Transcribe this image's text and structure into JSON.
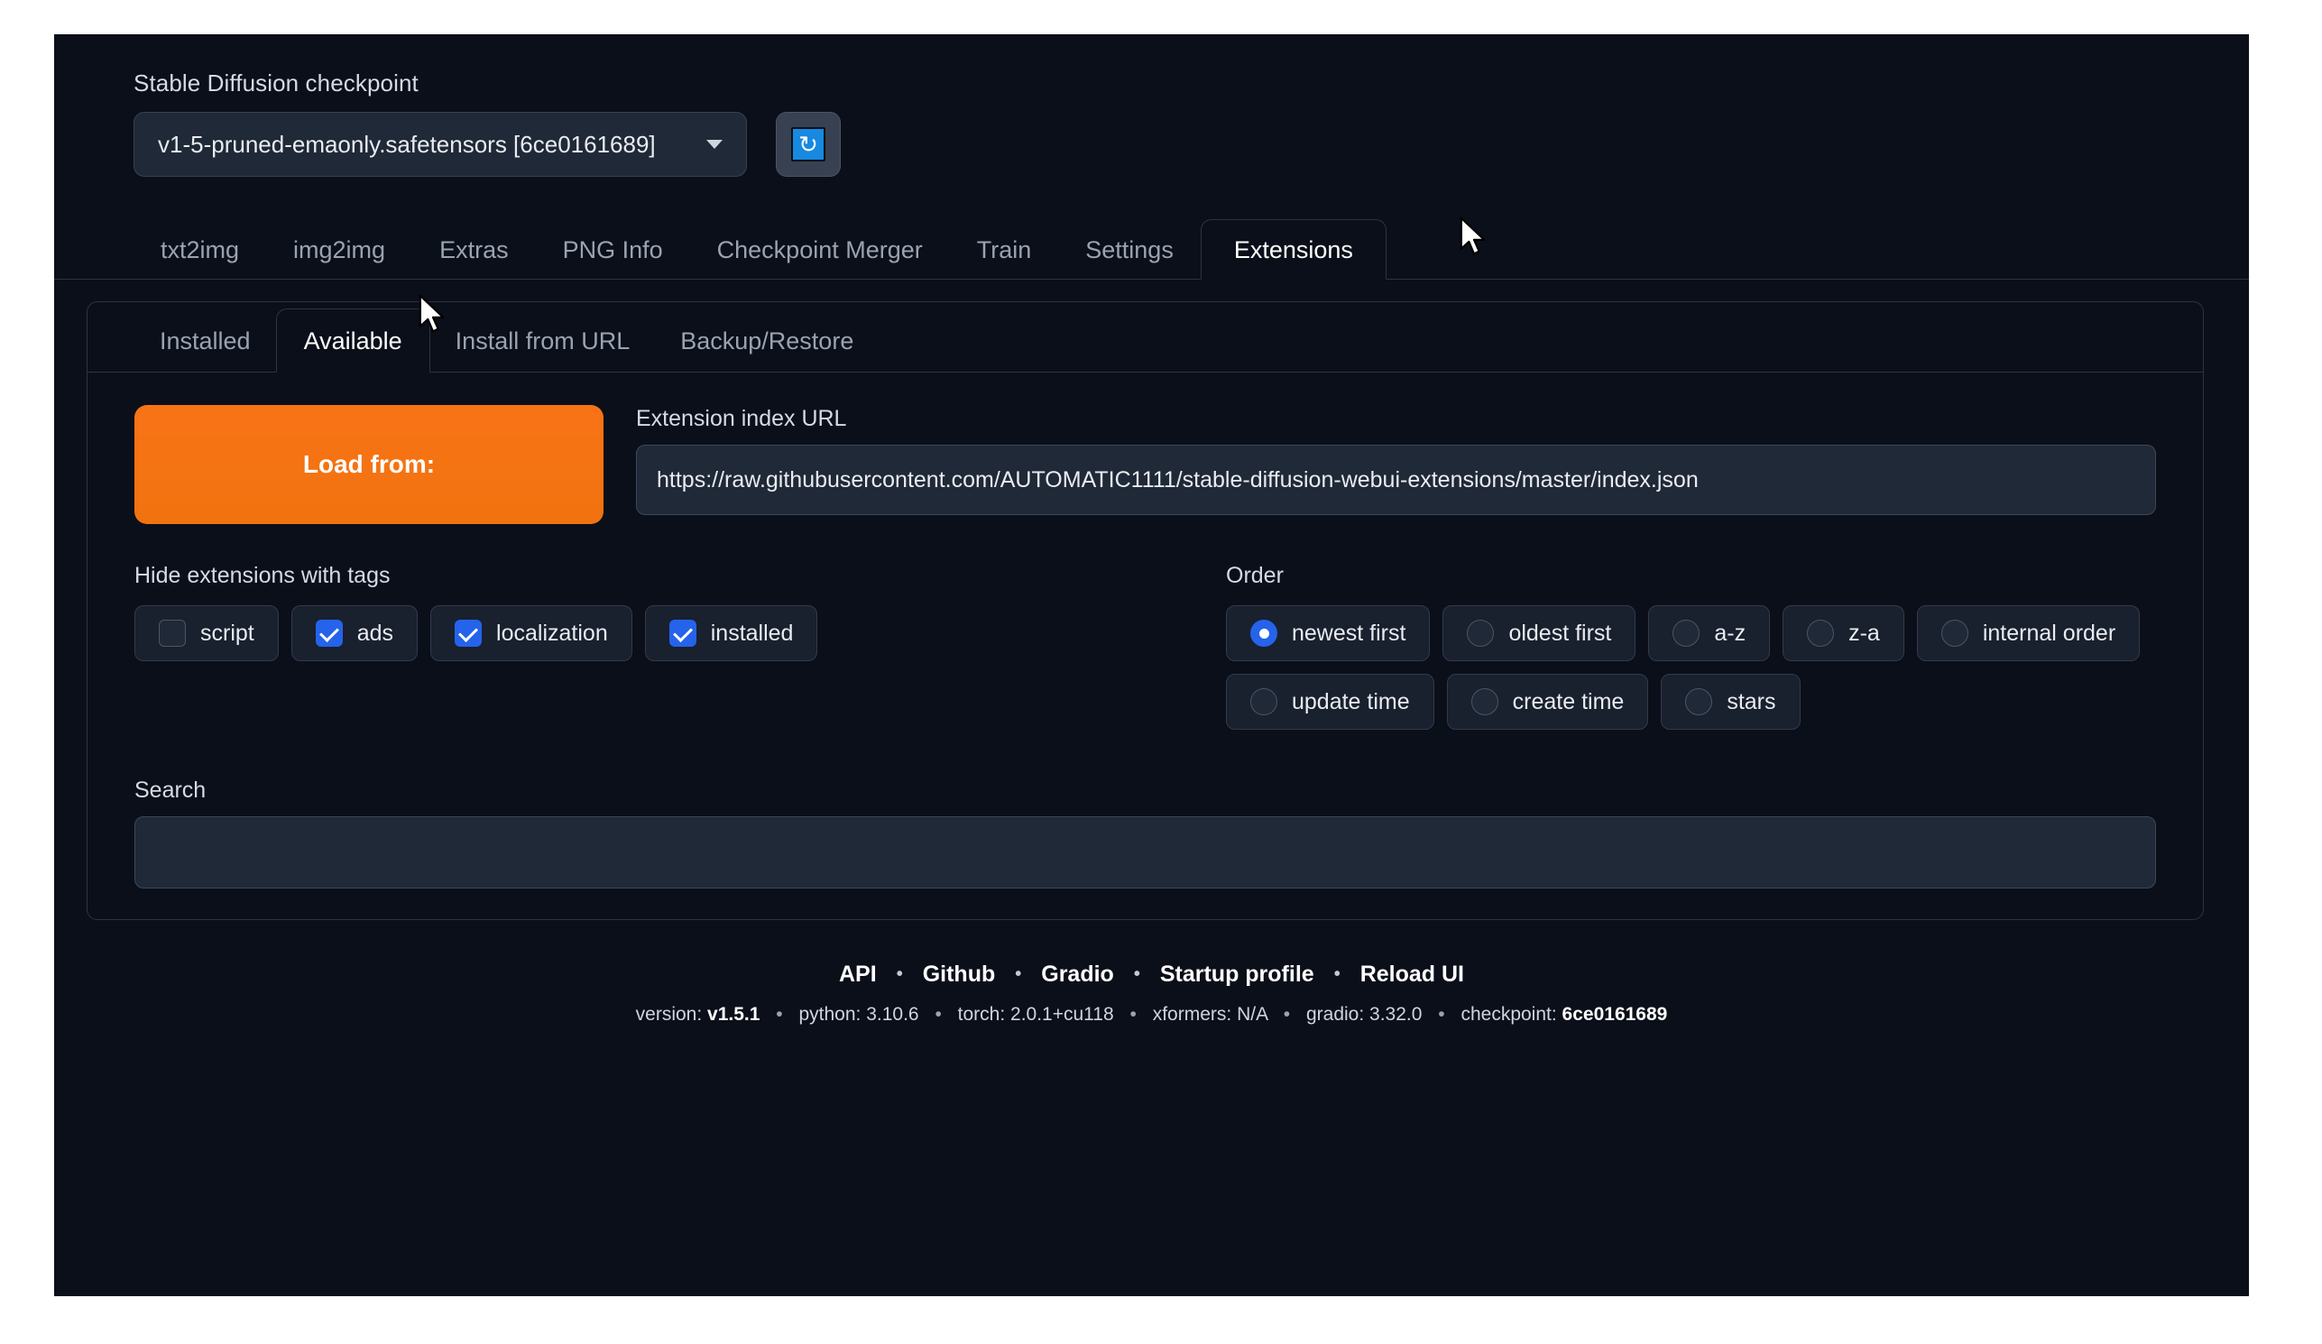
{
  "checkpoint": {
    "label": "Stable Diffusion checkpoint",
    "value": "v1-5-pruned-emaonly.safetensors [6ce0161689]",
    "refresh_icon": "refresh-icon"
  },
  "main_tabs": [
    {
      "label": "txt2img",
      "selected": false
    },
    {
      "label": "img2img",
      "selected": false
    },
    {
      "label": "Extras",
      "selected": false
    },
    {
      "label": "PNG Info",
      "selected": false
    },
    {
      "label": "Checkpoint Merger",
      "selected": false
    },
    {
      "label": "Train",
      "selected": false
    },
    {
      "label": "Settings",
      "selected": false
    },
    {
      "label": "Extensions",
      "selected": true
    }
  ],
  "sub_tabs": [
    {
      "label": "Installed",
      "selected": false
    },
    {
      "label": "Available",
      "selected": true
    },
    {
      "label": "Install from URL",
      "selected": false
    },
    {
      "label": "Backup/Restore",
      "selected": false
    }
  ],
  "extensions": {
    "load_button": "Load from:",
    "index_url_label": "Extension index URL",
    "index_url_value": "https://raw.githubusercontent.com/AUTOMATIC1111/stable-diffusion-webui-extensions/master/index.json",
    "hide_tags_label": "Hide extensions with tags",
    "hide_tags": [
      {
        "label": "script",
        "checked": false
      },
      {
        "label": "ads",
        "checked": true
      },
      {
        "label": "localization",
        "checked": true
      },
      {
        "label": "installed",
        "checked": true
      }
    ],
    "order_label": "Order",
    "order_row1": [
      {
        "label": "newest first",
        "checked": true
      },
      {
        "label": "oldest first",
        "checked": false
      },
      {
        "label": "a-z",
        "checked": false
      },
      {
        "label": "z-a",
        "checked": false
      },
      {
        "label": "internal order",
        "checked": false
      }
    ],
    "order_row2": [
      {
        "label": "update time",
        "checked": false
      },
      {
        "label": "create time",
        "checked": false
      },
      {
        "label": "stars",
        "checked": false
      }
    ],
    "search_label": "Search",
    "search_value": "",
    "search_placeholder": ""
  },
  "footer": {
    "links": [
      "API",
      "Github",
      "Gradio",
      "Startup profile",
      "Reload UI"
    ],
    "separator": "•",
    "version": {
      "version_key": "version:",
      "version_value": "v1.5.1",
      "python_key": "python:",
      "python_value": "3.10.6",
      "torch_key": "torch:",
      "torch_value": "2.0.1+cu118",
      "xformers_key": "xformers:",
      "xformers_value": "N/A",
      "gradio_key": "gradio:",
      "gradio_value": "3.32.0",
      "checkpoint_key": "checkpoint:",
      "checkpoint_value": "6ce0161689"
    }
  },
  "colors": {
    "accent_orange": "#f97316",
    "accent_blue": "#2563eb",
    "background": "#0b0f19",
    "panel": "#1f2937"
  }
}
